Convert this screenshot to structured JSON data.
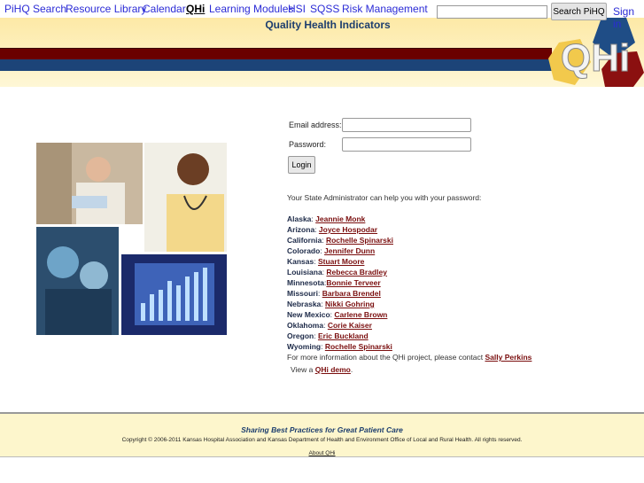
{
  "nav": {
    "items": [
      "PiHQ Search",
      "Resource Library",
      "Calendar",
      "QHi",
      "Learning Modules",
      "HSI",
      "SQSS",
      "Risk Management"
    ],
    "active": "QHi",
    "search_button": "Search PiHQ",
    "search_value": "",
    "sign_in": "Sign in"
  },
  "header": {
    "title": "Quality Health Indicators",
    "logo_text": "QHi"
  },
  "login": {
    "email_label": "Email address:",
    "password_label": "Password:",
    "email_value": "",
    "password_value": "",
    "login_button": "Login"
  },
  "admin_intro": "Your State Administrator can help you with your password:",
  "states": [
    {
      "state": "Alaska",
      "sep": ": ",
      "name": "Jeannie Monk"
    },
    {
      "state": "Arizona",
      "sep": ": ",
      "name": "Joyce Hospodar"
    },
    {
      "state": "California",
      "sep": ": ",
      "name": "Rochelle Spinarski"
    },
    {
      "state": "Colorado",
      "sep": ": ",
      "name": "Jennifer Dunn"
    },
    {
      "state": "Kansas",
      "sep": ": ",
      "name": "Stuart Moore"
    },
    {
      "state": "Louisiana",
      "sep": ": ",
      "name": "Rebecca Bradley"
    },
    {
      "state": "Minnesota",
      "sep": ":",
      "name": "Bonnie Terveer"
    },
    {
      "state": "Missouri",
      "sep": ": ",
      "name": "Barbara Brendel"
    },
    {
      "state": "Nebraska",
      "sep": ": ",
      "name": "Nikki Gohring"
    },
    {
      "state": "New Mexico",
      "sep": ": ",
      "name": "Carlene Brown"
    },
    {
      "state": "Oklahoma",
      "sep": ": ",
      "name": "Corie Kaiser"
    },
    {
      "state": "Oregon",
      "sep": ": ",
      "name": "Eric Buckland"
    },
    {
      "state": "Wyoming",
      "sep": ": ",
      "name": "Rochelle Spinarski"
    }
  ],
  "more_info": {
    "text": "For more information about the QHi project, please contact ",
    "contact": "Sally Perkins"
  },
  "demo": {
    "prefix": "View a ",
    "link": "QHi demo",
    "suffix": "."
  },
  "footer": {
    "tagline": "Sharing Best Practices for Great Patient Care",
    "copyright": "Copyright © 2006-2011 Kansas Hospital Association and Kansas Department of Health and Environment Office of Local and Rural Health. All rights reserved.",
    "about": "About QHi"
  },
  "colors": {
    "nav_link": "#2b2bd6",
    "band_red": "#6a0000",
    "band_blue": "#1c4478",
    "link_red": "#7a0e0e",
    "header_yellow": "#fde9a6"
  }
}
